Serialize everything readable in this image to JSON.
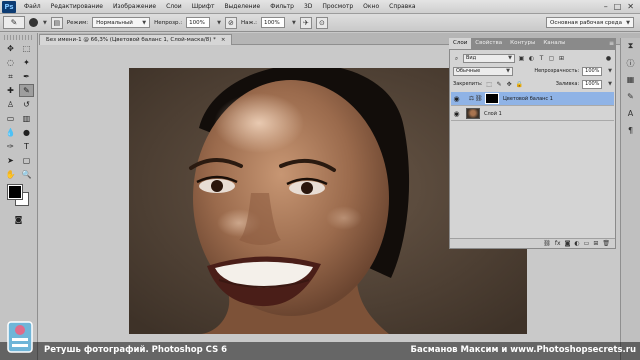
{
  "app": {
    "logo": "Ps"
  },
  "menu": [
    "Файл",
    "Редактирование",
    "Изображение",
    "Слои",
    "Шрифт",
    "Выделение",
    "Фильтр",
    "3D",
    "Просмотр",
    "Окно",
    "Справка"
  ],
  "window_controls": [
    "–",
    "□",
    "✕"
  ],
  "options": {
    "mode_label": "Режим:",
    "mode_value": "Нормальный",
    "opacity_label": "Непрозр.:",
    "opacity_value": "100%",
    "flow_label": "Наж.:",
    "flow_value": "100%",
    "workspace": "Основная рабочая среда"
  },
  "document": {
    "tab_title": "Без имени-1 @ 66,3% (Цветовой баланс 1, Слой-маска/8) *",
    "close": "×"
  },
  "panel_tabs": [
    "Слои",
    "Свойства",
    "Контуры",
    "Каналы"
  ],
  "layers_panel": {
    "filter_value": "Вид",
    "blend_mode": "Обычные",
    "opacity_label": "Непрозрачность:",
    "opacity_value": "100%",
    "lock_label": "Закрепить:",
    "fill_label": "Заливка:",
    "fill_value": "100%",
    "layers": [
      {
        "name": "Цветовой баланс 1",
        "selected": true
      },
      {
        "name": "Слой 1",
        "selected": false
      }
    ],
    "bottom_icons": [
      "link-icon",
      "fx-icon",
      "mask-icon",
      "adjustment-icon",
      "group-icon",
      "new-layer-icon",
      "trash-icon"
    ]
  },
  "caption": {
    "left": "Ретушь фотографий. Photoshop CS 6",
    "right": "Басманов Максим и www.Photoshopsecrets.ru"
  },
  "colors": {
    "accent_selected": "#8fb3e6",
    "photo_background": "#5a4a3a",
    "foreground": "#000000",
    "background": "#ffffff"
  }
}
